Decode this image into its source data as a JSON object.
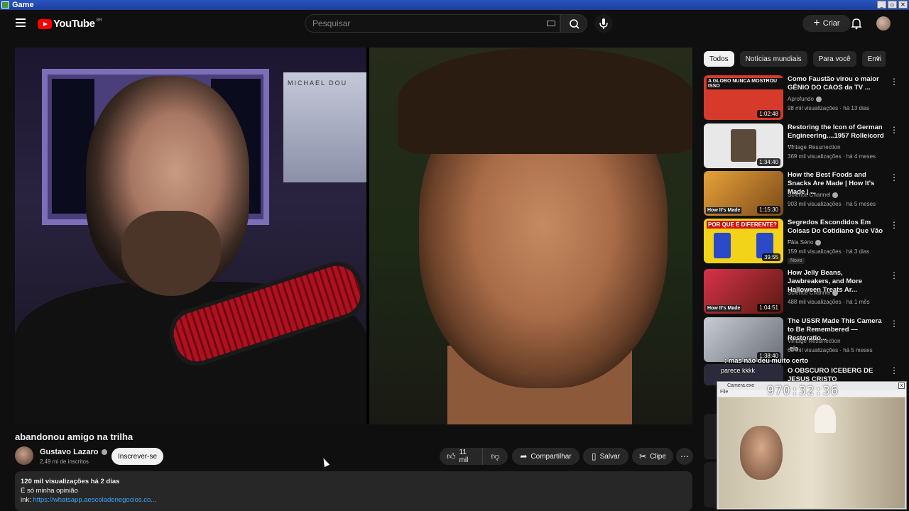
{
  "window": {
    "title": "Game",
    "buttons": [
      "_",
      "▫",
      "✕"
    ]
  },
  "header": {
    "logo_text": "YouTube",
    "country": "BR",
    "search_placeholder": "Pesquisar",
    "create_label": "Criar"
  },
  "video": {
    "title": "abandonou amigo na trilha",
    "poster_text": "MICHAEL DOU",
    "channel": {
      "name": "Gustavo Lazaro",
      "subscribers": "2,49 mi de inscritos"
    },
    "subscribe_label": "Inscrever-se",
    "actions": {
      "likes": "11 mil",
      "share": "Compartilhar",
      "save": "Salvar",
      "clip": "Clipe",
      "more": "⋯"
    },
    "description": {
      "stats": "120 mil visualizações  há 2 dias",
      "line1": "É só minha opinião",
      "link_prefix": "ink: ",
      "link": "https://whatsapp.aescoladenegocios.co..."
    }
  },
  "chips": [
    "Todos",
    "Notícias mundiais",
    "Para você",
    "Envi"
  ],
  "recommendations": [
    {
      "title": "Como Faustão virou o maior GÊNIO DO CAOS da TV ...",
      "channel": "Aprofundo",
      "verified": true,
      "meta": "98 mil visualizações · há 13 dias",
      "duration": "1:02:48",
      "thumb_text": "A GLOBO NUNCA MOSTROU ISSO",
      "color": "#d63a2a"
    },
    {
      "title": "Restoring the Icon of German Engineering....1957 Rolleicord ...",
      "channel": "Vintage Resurrection",
      "verified": false,
      "meta": "369 mil visualizações · há 4 meses",
      "duration": "1:34:40",
      "thumb_text": "",
      "color": "#e8e8e8"
    },
    {
      "title": "How the Best Foods and Snacks Are Made | How It's Made | ...",
      "channel": "Science Channel",
      "verified": true,
      "meta": "903 mil visualizações · há 5 meses",
      "duration": "1:15:30",
      "thumb_text": "How It's Made",
      "color": "#c8861e"
    },
    {
      "title": "Segredos Escondidos Em Coisas Do Cotidiano Que Vão ...",
      "channel": "Fala Sério",
      "verified": true,
      "meta": "159 mil visualizações · há 3 dias",
      "duration": "39:55",
      "thumb_text": "POR QUE É DIFERENTE?",
      "color": "#f3d21a",
      "badge": "Novo"
    },
    {
      "title": "How Jelly Beans, Jawbreakers, and More Halloween Treats Ar...",
      "channel": "Science Channel",
      "verified": true,
      "meta": "488 mil visualizações · há 1 mês",
      "duration": "1:04:51",
      "thumb_text": "How It's Made",
      "color": "#b4381e"
    },
    {
      "title": "The USSR Made This Camera to Be Remembered — Restoratio...",
      "channel": "Vintage Resurrection",
      "verified": false,
      "meta": "65 mil visualizações · há 5 meses",
      "duration": "1:38:40",
      "thumb_text": "",
      "color": "#9aa0a8"
    },
    {
      "title": "O OBSCURO ICEBERG DE JESUS CRISTO",
      "channel": "",
      "verified": false,
      "meta": "",
      "duration": "",
      "thumb_text": "",
      "color": "#2a2a3a"
    }
  ],
  "chat": {
    "line1": ": mas não deu muito certo",
    "line2": "parece kkkk",
    "line3": "ela"
  },
  "overlay": {
    "title": "Camera.exe",
    "menu": "File",
    "timer": "970:32:36",
    "close": "x"
  },
  "colors": {
    "bg": "#0f0f0f",
    "accent": "#f00",
    "link": "#3ea6ff"
  }
}
